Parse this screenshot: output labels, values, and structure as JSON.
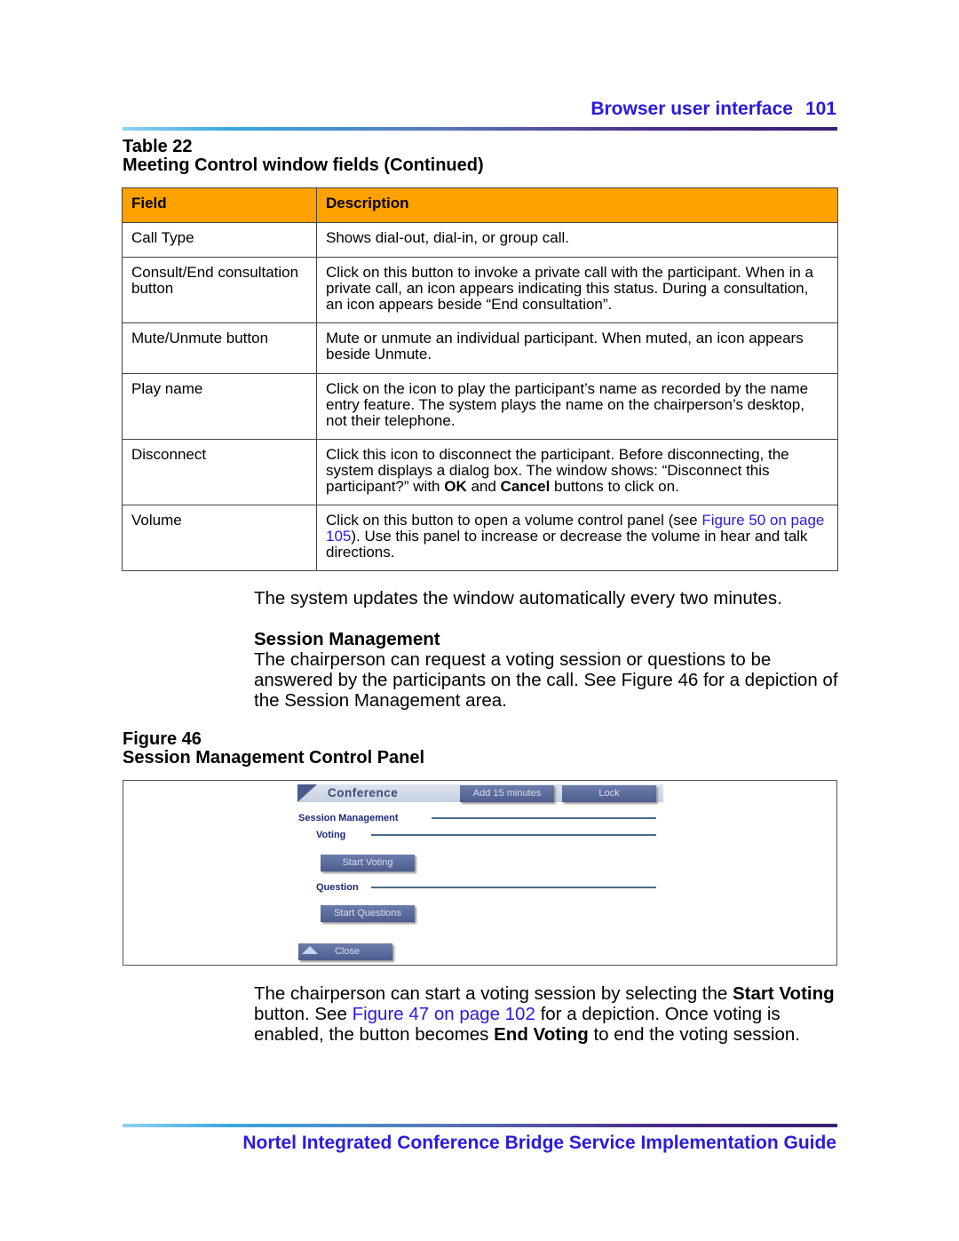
{
  "header": {
    "section": "Browser user interface",
    "page": "101"
  },
  "table": {
    "number": "Table 22",
    "title": "Meeting Control window fields (Continued)",
    "columns": [
      "Field",
      "Description"
    ],
    "rows": [
      {
        "field": "Call Type",
        "description": "Shows dial-out, dial-in, or group call."
      },
      {
        "field": "Consult/End consultation button",
        "description": "Click on this button to invoke a private call with the participant. When in a private call, an icon appears indicating this status. During a consultation, an icon appears beside “End consultation”."
      },
      {
        "field": "Mute/Unmute button",
        "description": "Mute or unmute an individual participant. When muted, an icon appears beside Unmute."
      },
      {
        "field": "Play name",
        "description": "Click on the icon to play the participant’s name as recorded by the name entry feature. The system plays the name on the chairperson’s desktop, not their telephone."
      },
      {
        "field": "Disconnect",
        "d1": "Click this icon to disconnect the participant. Before disconnecting, the system displays a dialog box. The window shows: “Disconnect this participant?” with ",
        "d2": "OK",
        "d3": " and ",
        "d4": "Cancel",
        "d5": " buttons to click on."
      },
      {
        "field": "Volume",
        "d1": "Click on this button to open a volume control panel (see ",
        "link": "Figure 50 on page 105",
        "d2": "). Use this panel to increase or decrease the volume in hear and talk directions."
      }
    ]
  },
  "para1": "The system updates the window automatically every two minutes.",
  "session": {
    "heading": "Session Management",
    "text": "The chairperson can request a voting session or questions to be answered by the participants on the call. See Figure 46 for a depiction of the Session Management area."
  },
  "figure": {
    "number": "Figure 46",
    "title": "Session Management Control Panel",
    "panel": {
      "title": "Conference",
      "add_button": "Add 15 minutes",
      "lock_button": "Lock",
      "section": "Session Management",
      "voting": "Voting",
      "start_voting": "Start Voting",
      "question": "Question",
      "start_questions": "Start Questions",
      "close": "Close"
    }
  },
  "para2": {
    "t1": "The chairperson can start a voting session by selecting the ",
    "b1": "Start Voting",
    "t2": " button. See ",
    "link": "Figure 47 on page 102",
    "t3": " for a depiction. Once voting is enabled, the button becomes ",
    "b2": "End Voting",
    "t4": " to end the voting session."
  },
  "footer": "Nortel Integrated Conference Bridge Service Implementation Guide"
}
